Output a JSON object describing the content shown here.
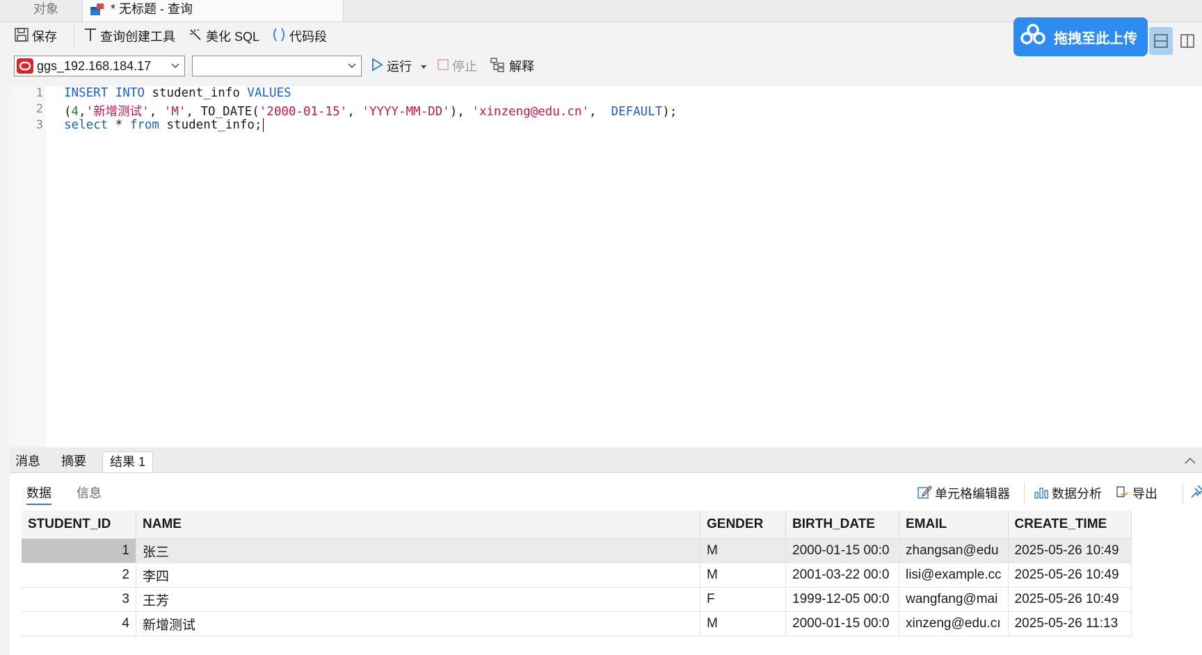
{
  "tabs": {
    "objects": "对象",
    "query": "* 无标题 - 查询"
  },
  "toolbar": {
    "save": "保存",
    "query_builder": "查询创建工具",
    "beautify": "美化 SQL",
    "snippet": "代码段",
    "connection": "ggs_192.168.184.17",
    "database": "",
    "run": "运行",
    "stop": "停止",
    "explain": "解释",
    "upload": "拖拽至此上传"
  },
  "editor": {
    "line_numbers": [
      "1",
      "2",
      "3"
    ],
    "lines": [
      "INSERT INTO student_info VALUES",
      "(4,'新增测试', 'M', TO_DATE('2000-01-15', 'YYYY-MM-DD'), 'xinzeng@edu.cn',  DEFAULT);",
      "select * from student_info;"
    ]
  },
  "result_tabs": [
    "消息",
    "摘要",
    "结果 1"
  ],
  "result_panel": {
    "subtabs": [
      "数据",
      "信息"
    ],
    "cell_editor": "单元格编辑器",
    "data_analysis": "数据分析",
    "export": "导出"
  },
  "grid": {
    "columns": [
      "STUDENT_ID",
      "NAME",
      "GENDER",
      "BIRTH_DATE",
      "EMAIL",
      "CREATE_TIME"
    ],
    "rows": [
      [
        "1",
        "张三",
        "M",
        "2000-01-15 00:0",
        "zhangsan@edu",
        "2025-05-26 10:49"
      ],
      [
        "2",
        "李四",
        "M",
        "2001-03-22 00:0",
        "lisi@example.cc",
        "2025-05-26 10:49"
      ],
      [
        "3",
        "王芳",
        "F",
        "1999-12-05 00:0",
        "wangfang@mai",
        "2025-05-26 10:49"
      ],
      [
        "4",
        "新增测试",
        "M",
        "2000-01-15 00:0",
        "xinzeng@edu.cı",
        "2025-05-26 11:13"
      ]
    ]
  },
  "colors": {
    "keyword": "#1a5fd8",
    "string": "#c6174f",
    "number": "#1a8a2a",
    "accent": "#2e8cf0"
  }
}
